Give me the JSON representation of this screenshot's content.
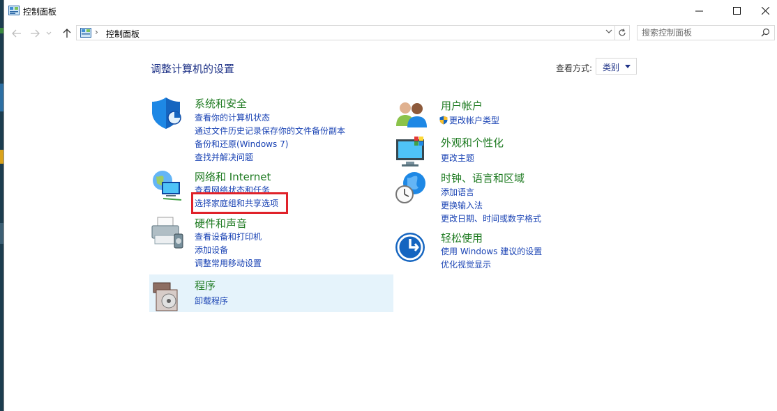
{
  "window": {
    "title": "控制面板"
  },
  "address_bar": {
    "breadcrumb": "控制面板",
    "search_placeholder": "搜索控制面板"
  },
  "content": {
    "heading": "调整计算机的设置",
    "view_by_label": "查看方式:",
    "view_by_value": "类别"
  },
  "categories": [
    {
      "title": "系统和安全",
      "links": [
        "查看你的计算机状态",
        "通过文件历史记录保存你的文件备份副本",
        "备份和还原(Windows 7)",
        "查找并解决问题"
      ],
      "icon": "shield-icon"
    },
    {
      "title": "网络和 Internet",
      "links": [
        "查看网络状态和任务",
        "选择家庭组和共享选项"
      ],
      "icon": "network-icon"
    },
    {
      "title": "硬件和声音",
      "links": [
        "查看设备和打印机",
        "添加设备",
        "调整常用移动设置"
      ],
      "icon": "printer-icon"
    },
    {
      "title": "程序",
      "links": [
        "卸载程序"
      ],
      "icon": "programs-icon"
    },
    {
      "title": "用户帐户",
      "links": [
        "更改帐户类型"
      ],
      "icon": "users-icon"
    },
    {
      "title": "外观和个性化",
      "links": [
        "更改主题"
      ],
      "icon": "monitor-icon"
    },
    {
      "title": "时钟、语言和区域",
      "links": [
        "添加语言",
        "更换输入法",
        "更改日期、时间或数字格式"
      ],
      "icon": "clock-globe-icon"
    },
    {
      "title": "轻松使用",
      "links": [
        "使用 Windows 建议的设置",
        "优化视觉显示"
      ],
      "icon": "ease-of-access-icon"
    }
  ],
  "colors": {
    "category_title": "#1d7a20",
    "link": "#1a43b4",
    "heading": "#1e3287",
    "highlight": "#e0222a",
    "programs_hover": "#e5f3fb"
  }
}
